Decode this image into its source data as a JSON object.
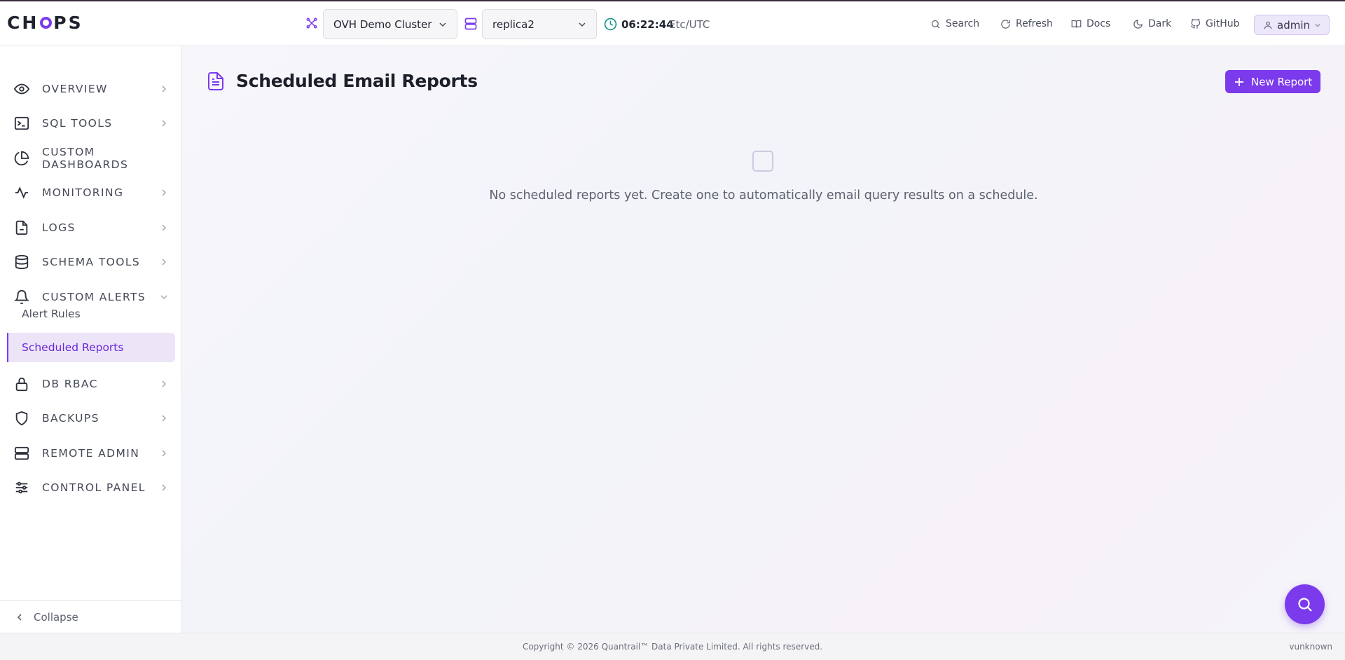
{
  "app": {
    "logo_text_1": "CH",
    "logo_text_2": "PS"
  },
  "header": {
    "cluster": "OVH Demo Cluster",
    "replica": "replica2",
    "time": "06:22:44",
    "timezone": "Etc/UTC",
    "buttons": {
      "search": "Search",
      "refresh": "Refresh",
      "docs": "Docs",
      "dark": "Dark",
      "github": "GitHub"
    },
    "user": "admin"
  },
  "sidebar": {
    "items": [
      {
        "label": "OVERVIEW",
        "icon": "eye-icon"
      },
      {
        "label": "SQL TOOLS",
        "icon": "terminal-icon"
      },
      {
        "label": "CUSTOM DASHBOARDS",
        "icon": "pie-chart-icon"
      },
      {
        "label": "MONITORING",
        "icon": "activity-icon"
      },
      {
        "label": "LOGS",
        "icon": "file-icon"
      },
      {
        "label": "SCHEMA TOOLS",
        "icon": "database-icon"
      },
      {
        "label": "CUSTOM ALERTS",
        "icon": "bell-icon"
      },
      {
        "label": "DB RBAC",
        "icon": "lock-icon"
      },
      {
        "label": "BACKUPS",
        "icon": "shield-icon"
      },
      {
        "label": "REMOTE ADMIN",
        "icon": "server-icon"
      },
      {
        "label": "CONTROL PANEL",
        "icon": "sliders-icon"
      }
    ],
    "sub_items": [
      {
        "label": "Alert Rules"
      },
      {
        "label": "Scheduled Reports",
        "active": true
      }
    ],
    "collapse": "Collapse"
  },
  "main": {
    "title": "Scheduled Email Reports",
    "new_button": "New Report",
    "empty_message": "No scheduled reports yet. Create one to automatically email query results on a schedule."
  },
  "footer": {
    "copyright": "Copyright © 2026 Quantrail™ Data Private Limited. All rights reserved.",
    "version": "vunknown"
  },
  "colors": {
    "accent": "#7c3aed",
    "active_bg": "#ece5f8"
  }
}
